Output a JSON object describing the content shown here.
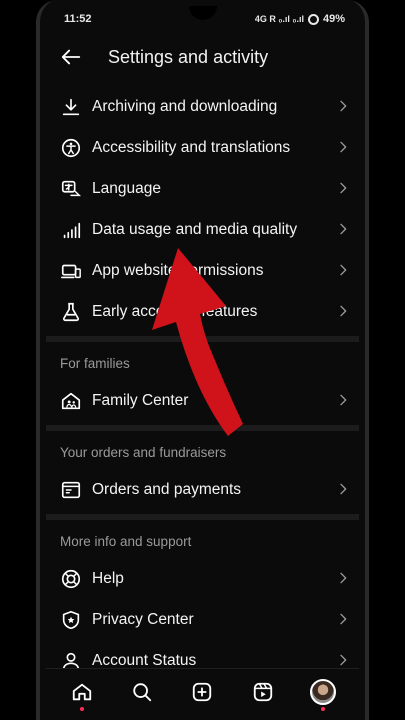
{
  "status": {
    "time": "11:52",
    "network": "4G R ₀.ıl ₀.ıl",
    "battery": "49%"
  },
  "header": {
    "title": "Settings and activity"
  },
  "items_top": [
    {
      "label": "Archiving and downloading",
      "icon": "download-icon"
    },
    {
      "label": "Accessibility and translations",
      "icon": "accessibility-icon"
    },
    {
      "label": "Language",
      "icon": "translate-icon"
    },
    {
      "label": "Data usage and media quality",
      "icon": "signal-bars-icon"
    },
    {
      "label": "App website permissions",
      "icon": "devices-icon"
    },
    {
      "label": "Early access to features",
      "icon": "flask-icon"
    }
  ],
  "sections": {
    "families": {
      "title": "For families",
      "items": [
        {
          "label": "Family Center",
          "icon": "home-family-icon"
        }
      ]
    },
    "orders": {
      "title": "Your orders and fundraisers",
      "items": [
        {
          "label": "Orders and payments",
          "icon": "receipt-icon"
        }
      ]
    },
    "support": {
      "title": "More info and support",
      "items": [
        {
          "label": "Help",
          "icon": "lifebuoy-icon"
        },
        {
          "label": "Privacy Center",
          "icon": "shield-star-icon"
        },
        {
          "label": "Account Status",
          "icon": "person-icon"
        }
      ]
    }
  },
  "bottom_nav": [
    "home-icon",
    "search-icon",
    "create-icon",
    "reels-icon",
    "profile-avatar"
  ],
  "colors": {
    "background": "#0b0b0b",
    "divider": "#1c1c1c",
    "arrow": "#d0121b",
    "notification_dot": "#ff2d55"
  }
}
